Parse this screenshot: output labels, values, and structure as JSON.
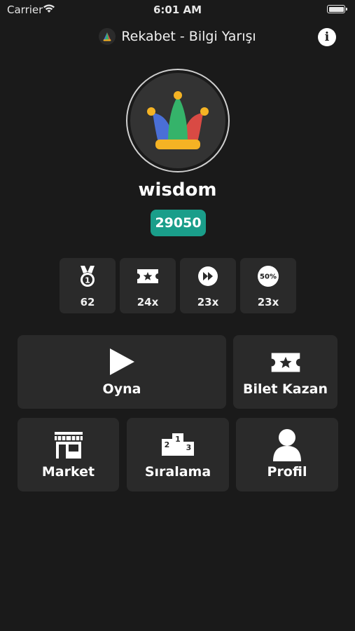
{
  "status_bar": {
    "carrier": "Carrier",
    "time": "6:01 AM"
  },
  "nav": {
    "title": "Rekabet - Bilgi Yarışı",
    "info_icon_glyph": "i"
  },
  "profile": {
    "username": "wisdom",
    "score": "29050"
  },
  "stats": [
    {
      "icon": "medal-icon",
      "value": "62"
    },
    {
      "icon": "ticket-icon",
      "value": "24x"
    },
    {
      "icon": "fast-forward-icon",
      "value": "23x"
    },
    {
      "icon": "fifty-fifty-icon",
      "icon_text": "50%",
      "value": "23x"
    }
  ],
  "actions": {
    "play": "Oyna",
    "earn_ticket": "Bilet Kazan",
    "market": "Market",
    "ranking": "Sıralama",
    "profile": "Profil"
  },
  "ranking_icon_digits": [
    "2",
    "1",
    "3"
  ],
  "colors": {
    "background": "#1a1a1a",
    "card": "#2a2a2a",
    "score_badge": "#1a9e8a",
    "jester_blue": "#4a6fd6",
    "jester_green": "#35b36a",
    "jester_red": "#d94a44",
    "jester_gold": "#f5b324"
  }
}
